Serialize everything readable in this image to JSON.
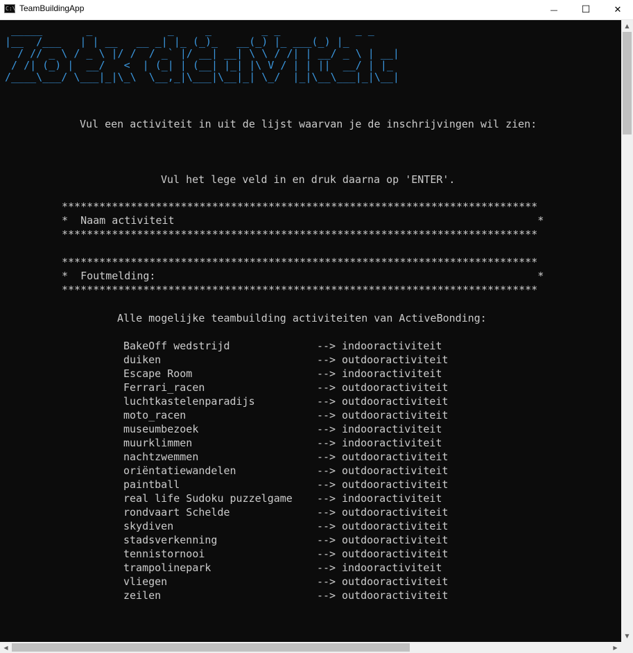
{
  "window": {
    "title": "TeamBuildingApp",
    "app_icon_text": "C:\\",
    "minimize_glyph": "—",
    "maximize_glyph": "☐",
    "close_glyph": "✕"
  },
  "colors": {
    "console_bg": "#0c0c0c",
    "console_text": "#cccccc",
    "banner": "#3a96dd"
  },
  "banner_ascii": " _____       _            _     _        _ _            _ _\n|__  /___   | | __   __ _| |_ (_)_   __(_) |_ ___(_) |_\n  / // _ \\ / _ \\ |/ /  / _` |/ __| __| \\ \\ / /| | __/ _ \\ | __|\n / /| (_) |  __/   <  | (_| | (__| |_| |\\ V / | | ||  __/ | |_\n/____\\___/ \\___|_|\\_\\  \\__,_|\\___|\\__|_| \\_/  |_|\\__\\___|_|\\__|",
  "instructions": {
    "line1": "Vul een activiteit in uit de lijst waarvan je de inschrijvingen wil zien:",
    "line2": "Vul het lege veld in en druk daarna op 'ENTER'."
  },
  "border_line": "****************************************************************************",
  "form": {
    "name_field_row": "*  Naam activiteit                                                          *",
    "error_field_row": "*  Foutmelding:                                                             *"
  },
  "list_heading": "Alle mogelijke teambuilding activiteiten van ActiveBonding:",
  "arrow": "-->",
  "activities": [
    {
      "name": "BakeOff wedstrijd",
      "type": "indooractiviteit"
    },
    {
      "name": "duiken",
      "type": "outdooractiviteit"
    },
    {
      "name": "Escape Room",
      "type": "indooractiviteit"
    },
    {
      "name": "Ferrari_racen",
      "type": "outdooractiviteit"
    },
    {
      "name": "luchtkastelenparadijs",
      "type": "outdooractiviteit"
    },
    {
      "name": "moto_racen",
      "type": "outdooractiviteit"
    },
    {
      "name": "museumbezoek",
      "type": "indooractiviteit"
    },
    {
      "name": "muurklimmen",
      "type": "indooractiviteit"
    },
    {
      "name": "nachtzwemmen",
      "type": "outdooractiviteit"
    },
    {
      "name": "oriëntatiewandelen",
      "type": "outdooractiviteit"
    },
    {
      "name": "paintball",
      "type": "outdooractiviteit"
    },
    {
      "name": "real life Sudoku puzzelgame",
      "type": "indooractiviteit"
    },
    {
      "name": "rondvaart Schelde",
      "type": "outdooractiviteit"
    },
    {
      "name": "skydiven",
      "type": "outdooractiviteit"
    },
    {
      "name": "stadsverkenning",
      "type": "outdooractiviteit"
    },
    {
      "name": "tennistornooi",
      "type": "outdooractiviteit"
    },
    {
      "name": "trampolinepark",
      "type": "indooractiviteit"
    },
    {
      "name": "vliegen",
      "type": "outdooractiviteit"
    },
    {
      "name": "zeilen",
      "type": "outdooractiviteit"
    }
  ],
  "scrollbars": {
    "up_arrow": "▲",
    "down_arrow": "▼",
    "left_arrow": "◀",
    "right_arrow": "▶"
  }
}
